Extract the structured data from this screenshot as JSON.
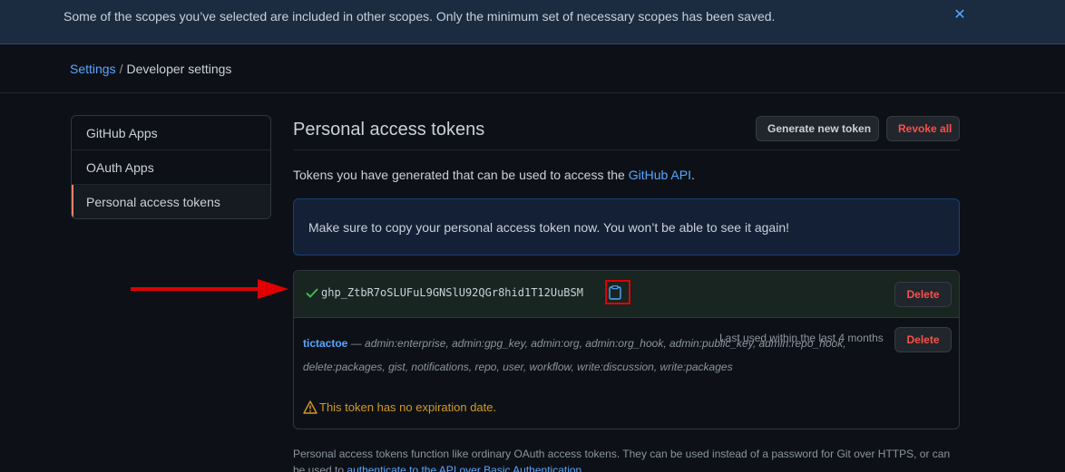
{
  "flash": {
    "message": "Some of the scopes you’ve selected are included in other scopes. Only the minimum set of necessary scopes has been saved.",
    "close_icon": "close-icon"
  },
  "breadcrumb": {
    "parent": "Settings",
    "separator": "/",
    "current": "Developer settings"
  },
  "sidebar": {
    "items": [
      {
        "label": "GitHub Apps"
      },
      {
        "label": "OAuth Apps"
      },
      {
        "label": "Personal access tokens",
        "selected": true
      }
    ]
  },
  "main": {
    "title": "Personal access tokens",
    "generate_label": "Generate new token",
    "revoke_label": "Revoke all",
    "intro_prefix": "Tokens you have generated that can be used to access the ",
    "intro_link": "GitHub API",
    "intro_suffix": ".",
    "notice": "Make sure to copy your personal access token now. You won’t be able to see it again!",
    "new_token": {
      "value": "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",
      "delete_label": "Delete"
    },
    "token": {
      "name": "tictactoe",
      "dash": " — ",
      "scopes": "admin:enterprise, admin:gpg_key, admin:org, admin:org_hook, admin:public_key, admin:repo_hook, delete:packages, gist, notifications, repo, user, workflow, write:discussion, write:packages",
      "last_used": "Last used within the last 4 months",
      "delete_label": "Delete",
      "warning": "This token has no expiration date."
    },
    "footnote_text": "Personal access tokens function like ordinary OAuth access tokens. They can be used instead of a password for Git over HTTPS, or can be used to ",
    "footnote_link": "authenticate to the API over Basic Authentication",
    "footnote_end": "."
  },
  "colors": {
    "background": "#0d1117",
    "link": "#58a6ff",
    "danger": "#f85149",
    "success": "#3fb950",
    "warning": "#d29922",
    "annotation": "#e00000"
  }
}
